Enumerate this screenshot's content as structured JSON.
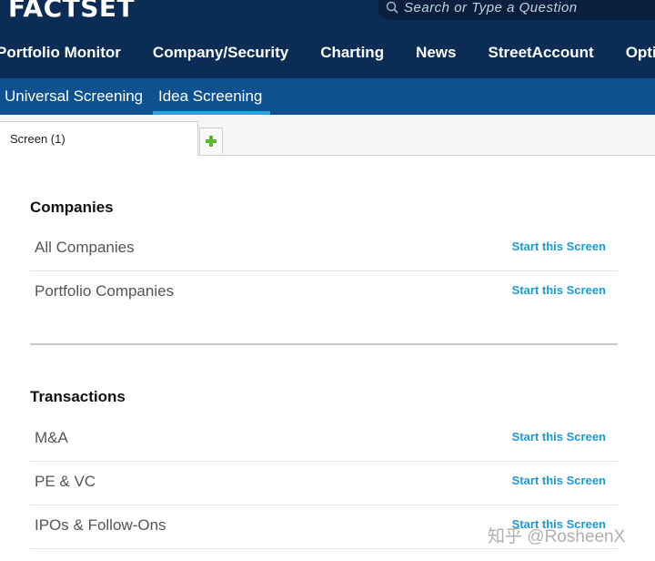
{
  "header": {
    "logo": "FACTSET",
    "search_placeholder": "Search or Type a Question",
    "nav": [
      "Portfolio Monitor",
      "Company/Security",
      "Charting",
      "News",
      "StreetAccount",
      "Options"
    ]
  },
  "subnav": {
    "tabs": [
      "Universal Screening",
      "Idea Screening"
    ],
    "active": "Idea Screening"
  },
  "tabs": {
    "screen_tab": "Screen (1)",
    "add_icon": "plus-icon"
  },
  "sections": [
    {
      "title": "Companies",
      "items": [
        {
          "label": "All Companies",
          "action": "Start this Screen"
        },
        {
          "label": "Portfolio Companies",
          "action": "Start this Screen"
        }
      ]
    },
    {
      "title": "Transactions",
      "items": [
        {
          "label": "M&A",
          "action": "Start this Screen"
        },
        {
          "label": "PE & VC",
          "action": "Start this Screen"
        },
        {
          "label": "IPOs & Follow-Ons",
          "action": "Start this Screen"
        }
      ]
    }
  ],
  "watermark": "知乎 @RosheenX",
  "colors": {
    "header_bg": "#0a2c55",
    "subnav_bg": "#0d5190",
    "active_underline": "#2aa3e0",
    "link": "#1a9ad6",
    "add_icon": "#5cb82f"
  }
}
